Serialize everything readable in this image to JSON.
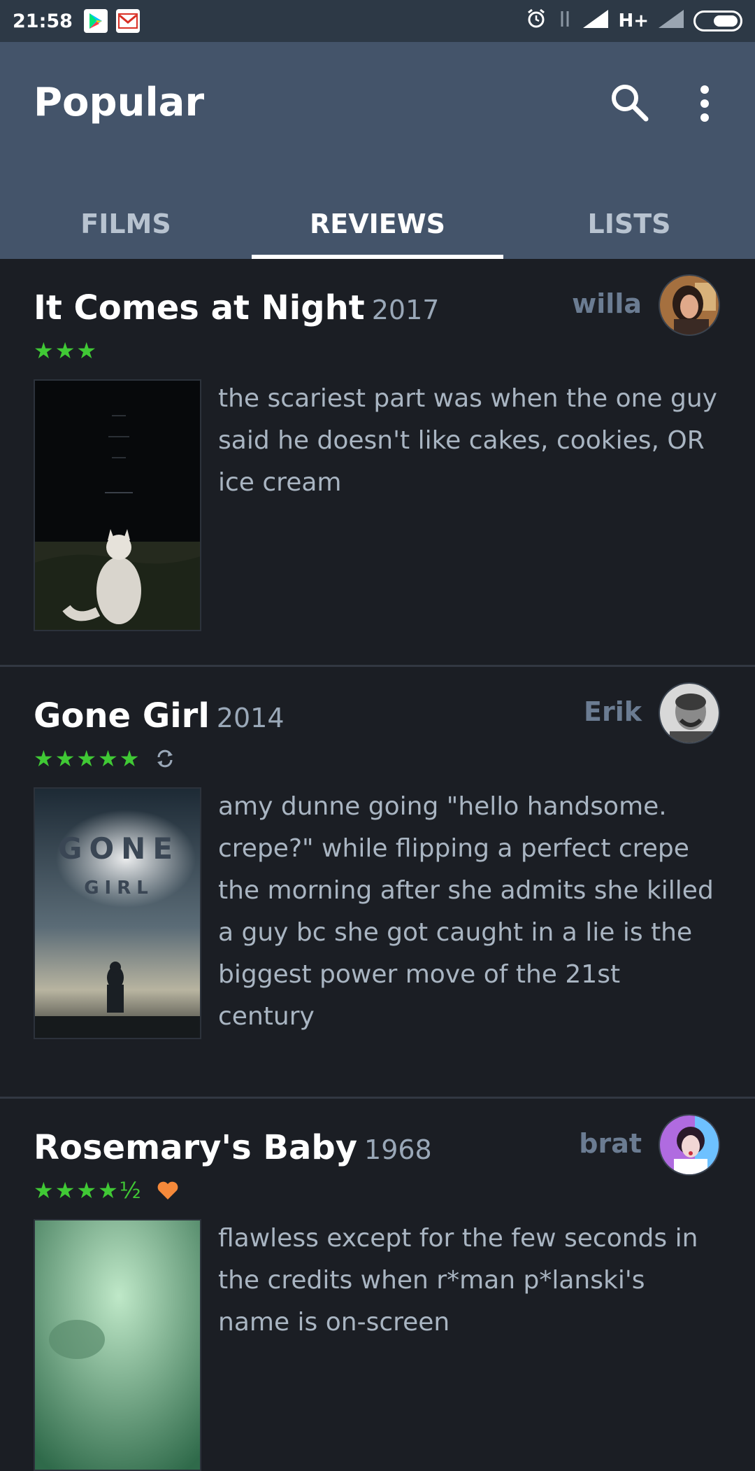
{
  "status_bar": {
    "time": "21:58",
    "network": "H+",
    "battery_level": 0.6
  },
  "app_bar": {
    "title": "Popular",
    "search_icon": "search-icon",
    "menu_icon": "more-vert-icon"
  },
  "tabs": [
    {
      "label": "FILMS",
      "active": false
    },
    {
      "label": "REVIEWS",
      "active": true
    },
    {
      "label": "LISTS",
      "active": false
    }
  ],
  "reviews": [
    {
      "title": "It Comes at Night",
      "year": "2017",
      "user": "willa",
      "rating": "★★★",
      "rewatch": false,
      "liked": false,
      "text": "the scariest part was when the one guy said he doesn't like cakes, cookies, OR ice cream"
    },
    {
      "title": "Gone Girl",
      "year": "2014",
      "user": "Erik",
      "rating": "★★★★★",
      "rewatch": true,
      "liked": false,
      "poster_title_1": "GONE",
      "poster_title_2": "GIRL",
      "text": "amy dunne going \"hello handsome. crepe?\" while flipping a perfect crepe the morning after she admits she killed a guy bc she got caught in a lie is the biggest power move of the 21st century"
    },
    {
      "title": "Rosemary's Baby",
      "year": "1968",
      "user": "brat",
      "rating": "★★★★½",
      "rewatch": false,
      "liked": true,
      "text": "flawless except for the few seconds in the credits when r*man p*lanski's name is on-screen"
    }
  ],
  "colors": {
    "star_green": "#40c935",
    "like_orange": "#f5893a",
    "app_bar": "#44546a",
    "background": "#1b1e24"
  }
}
